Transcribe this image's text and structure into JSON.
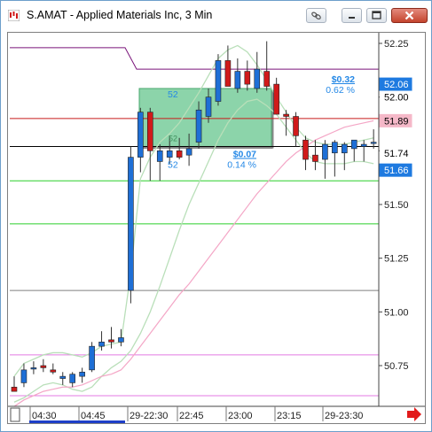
{
  "window": {
    "title": "S.AMAT - Applied Materials Inc, 3 Min",
    "icons": [
      "app-icon",
      "link-icon",
      "minimize-icon",
      "restore-icon",
      "close-icon"
    ]
  },
  "chart_data": {
    "type": "candlestick",
    "symbol": "S.AMAT",
    "interval": "3 Min",
    "ylim": [
      50.57,
      52.37
    ],
    "y_ticks": [
      "52.25",
      "52.00",
      "51.75",
      "51.50",
      "51.25",
      "51.00",
      "50.75"
    ],
    "x_ticks": [
      "04:30",
      "04:45",
      "29-22:30",
      "22:45",
      "23:00",
      "23:15",
      "29-23:30"
    ],
    "candles": [
      {
        "o": 50.65,
        "h": 50.7,
        "l": 50.63,
        "c": 50.63
      },
      {
        "o": 50.67,
        "h": 50.76,
        "l": 50.65,
        "c": 50.73
      },
      {
        "o": 50.74,
        "h": 50.77,
        "l": 50.71,
        "c": 50.74
      },
      {
        "o": 50.75,
        "h": 50.78,
        "l": 50.72,
        "c": 50.74
      },
      {
        "o": 50.73,
        "h": 50.76,
        "l": 50.71,
        "c": 50.72
      },
      {
        "o": 50.69,
        "h": 50.72,
        "l": 50.66,
        "c": 50.7
      },
      {
        "o": 50.67,
        "h": 50.72,
        "l": 50.65,
        "c": 50.71
      },
      {
        "o": 50.7,
        "h": 50.74,
        "l": 50.67,
        "c": 50.72
      },
      {
        "o": 50.73,
        "h": 50.86,
        "l": 50.72,
        "c": 50.84
      },
      {
        "o": 50.84,
        "h": 50.91,
        "l": 50.82,
        "c": 50.86
      },
      {
        "o": 50.87,
        "h": 50.93,
        "l": 50.83,
        "c": 50.86
      },
      {
        "o": 50.86,
        "h": 50.92,
        "l": 50.84,
        "c": 50.88
      },
      {
        "o": 51.1,
        "h": 51.77,
        "l": 51.04,
        "c": 51.72
      },
      {
        "o": 51.72,
        "h": 51.95,
        "l": 51.65,
        "c": 51.93
      },
      {
        "o": 51.93,
        "h": 51.95,
        "l": 51.61,
        "c": 51.75
      },
      {
        "o": 51.7,
        "h": 51.78,
        "l": 51.61,
        "c": 51.75
      },
      {
        "o": 51.72,
        "h": 51.82,
        "l": 51.69,
        "c": 51.75
      },
      {
        "o": 51.75,
        "h": 51.81,
        "l": 51.71,
        "c": 51.72
      },
      {
        "o": 51.73,
        "h": 51.83,
        "l": 51.68,
        "c": 51.76
      },
      {
        "o": 51.79,
        "h": 51.98,
        "l": 51.76,
        "c": 51.94
      },
      {
        "o": 51.91,
        "h": 52.04,
        "l": 51.88,
        "c": 52.0
      },
      {
        "o": 51.98,
        "h": 52.2,
        "l": 51.96,
        "c": 52.17
      },
      {
        "o": 52.17,
        "h": 52.24,
        "l": 52.05,
        "c": 52.05
      },
      {
        "o": 52.04,
        "h": 52.18,
        "l": 52.02,
        "c": 52.12
      },
      {
        "o": 52.12,
        "h": 52.17,
        "l": 52.03,
        "c": 52.06
      },
      {
        "o": 52.04,
        "h": 52.21,
        "l": 52.02,
        "c": 52.13
      },
      {
        "o": 52.12,
        "h": 52.26,
        "l": 52.03,
        "c": 52.05
      },
      {
        "o": 52.06,
        "h": 52.09,
        "l": 51.92,
        "c": 51.92
      },
      {
        "o": 51.92,
        "h": 51.94,
        "l": 51.82,
        "c": 51.91
      },
      {
        "o": 51.91,
        "h": 51.93,
        "l": 51.77,
        "c": 51.82
      },
      {
        "o": 51.8,
        "h": 51.82,
        "l": 51.66,
        "c": 51.71
      },
      {
        "o": 51.73,
        "h": 51.8,
        "l": 51.66,
        "c": 51.7
      },
      {
        "o": 51.71,
        "h": 51.8,
        "l": 51.62,
        "c": 51.78
      },
      {
        "o": 51.74,
        "h": 51.8,
        "l": 51.63,
        "c": 51.79
      },
      {
        "o": 51.74,
        "h": 51.79,
        "l": 51.66,
        "c": 51.78
      },
      {
        "o": 51.76,
        "h": 51.8,
        "l": 51.7,
        "c": 51.8
      },
      {
        "o": 51.77,
        "h": 51.8,
        "l": 51.7,
        "c": 51.78
      },
      {
        "o": 51.79,
        "h": 51.85,
        "l": 51.76,
        "c": 51.79
      }
    ],
    "up_color": "#1e6fd6",
    "down_color": "#d01a1a",
    "horizontal_levels": [
      {
        "value": 52.23,
        "color": "#7a147a",
        "step_from": 52.13
      },
      {
        "value": 51.9,
        "color": "#c81a1a"
      },
      {
        "value": 51.77,
        "color": "#000000"
      },
      {
        "value": 51.61,
        "color": "#2bcf2b"
      },
      {
        "value": 51.41,
        "color": "#2bcf2b"
      },
      {
        "value": 51.1,
        "color": "#7f7f7f"
      },
      {
        "value": 50.8,
        "color": "#e37ae3"
      },
      {
        "value": 50.61,
        "color": "#e37ae3"
      }
    ],
    "price_labels": [
      {
        "text": "52.06",
        "value": 52.06,
        "bg": "#1e7ae0",
        "fg": "#ffffff"
      },
      {
        "text": "52.00",
        "value": 52.0,
        "bg": "#ffffff",
        "fg": "#000000"
      },
      {
        "text": "51.89",
        "value": 51.89,
        "bg": "#f5b8c8",
        "fg": "#000000"
      },
      {
        "text": "51.74",
        "value": 51.74,
        "bg": "#ffffff",
        "fg": "#000000"
      },
      {
        "text": "51.66",
        "value": 51.66,
        "bg": "#1e7ae0",
        "fg": "#ffffff"
      }
    ],
    "position_box": {
      "top": 52.04,
      "bottom": 51.77,
      "color": "#5fc489",
      "left_label_top": "52",
      "left_label_bottom": "52",
      "middle_label": "52",
      "upper_change": "$0.32",
      "upper_pct": "0.62 %",
      "lower_change": "$0.07",
      "lower_pct": "0.14 %",
      "label_color": "#2488e6"
    },
    "bands": {
      "upper": [
        50.7,
        50.76,
        50.78,
        50.8,
        50.81,
        50.81,
        50.8,
        50.79,
        50.81,
        50.84,
        50.85,
        50.86,
        51.18,
        51.62,
        51.72,
        51.79,
        51.83,
        51.88,
        51.95,
        52.02,
        52.1,
        52.18,
        52.22,
        52.24,
        52.21,
        52.15,
        52.08,
        52.0,
        51.93,
        51.86,
        51.81,
        51.79,
        51.78,
        51.78,
        51.78,
        51.79,
        51.8,
        51.81
      ],
      "lower": [
        50.58,
        50.6,
        50.63,
        50.66,
        50.67,
        50.66,
        50.64,
        50.63,
        50.65,
        50.7,
        50.74,
        50.77,
        50.82,
        50.9,
        51.0,
        51.12,
        51.25,
        51.38,
        51.5,
        51.6,
        51.7,
        51.8,
        51.88,
        51.94,
        51.98,
        51.99,
        51.96,
        51.92,
        51.86,
        51.8,
        51.74,
        51.7,
        51.69,
        51.69,
        51.69,
        51.7,
        51.7,
        51.69
      ],
      "color": "#b9dfb9"
    },
    "ma": {
      "values": [
        50.56,
        50.59,
        50.61,
        50.63,
        50.64,
        50.65,
        50.65,
        50.66,
        50.68,
        50.7,
        50.71,
        50.73,
        50.78,
        50.84,
        50.9,
        50.96,
        51.02,
        51.08,
        51.13,
        51.19,
        51.25,
        51.31,
        51.37,
        51.43,
        51.49,
        51.55,
        51.6,
        51.65,
        51.7,
        51.74,
        51.77,
        51.8,
        51.82,
        51.84,
        51.86,
        51.87,
        51.88,
        51.89
      ],
      "color": "#f4a6c6"
    }
  }
}
